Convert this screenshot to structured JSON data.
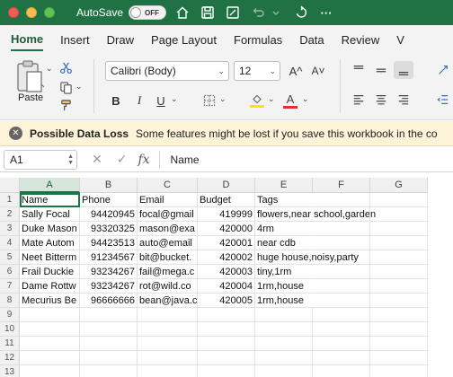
{
  "titlebar": {
    "autosave_label": "AutoSave",
    "autosave_state": "OFF",
    "more_label": "···"
  },
  "menu": {
    "tabs": [
      "Home",
      "Insert",
      "Draw",
      "Page Layout",
      "Formulas",
      "Data",
      "Review",
      "V"
    ],
    "active": "Home"
  },
  "ribbon": {
    "paste_label": "Paste",
    "font_name": "Calibri (Body)",
    "font_size": "12",
    "bold": "B",
    "italic": "I",
    "underline": "U",
    "grow_font": "A^",
    "shrink_font": "A˅",
    "font_color": "A",
    "font_color_hex": "#e03030",
    "highlight_hex": "#ffe600"
  },
  "warning": {
    "title": "Possible Data Loss",
    "message": "Some features might be lost if you save this workbook in the co"
  },
  "formula_bar": {
    "name_box": "A1",
    "fx": "fx",
    "value": "Name"
  },
  "grid": {
    "columns": [
      "A",
      "B",
      "C",
      "D",
      "E",
      "F",
      "G"
    ],
    "selected_column": "A",
    "row_numbers": [
      "1",
      "2",
      "3",
      "4",
      "5",
      "6",
      "7",
      "8",
      "9",
      "10",
      "11",
      "12",
      "13"
    ],
    "rows": [
      [
        "Name",
        "Phone",
        "Email",
        "Budget",
        "Tags"
      ],
      [
        "Sally Focal",
        "94420945",
        "focal@gmail",
        "419999",
        "flowers,near school,garden"
      ],
      [
        "Duke Mason",
        "93320325",
        "mason@exa",
        "420000",
        "4rm"
      ],
      [
        "Mate Autom",
        "94423513",
        "auto@email",
        "420001",
        "near cdb"
      ],
      [
        "Neet Bitterm",
        "91234567",
        "bit@bucket.",
        "420002",
        "huge house,noisy,party"
      ],
      [
        "Frail Duckie",
        "93234267",
        "fail@mega.c",
        "420003",
        "tiny,1rm"
      ],
      [
        "Dame Rottw",
        "93234267",
        "rot@wild.co",
        "420004",
        "1rm,house"
      ],
      [
        "Mecurius Be",
        "96666666",
        "bean@java.c",
        "420005",
        "1rm,house"
      ]
    ]
  },
  "colors": {
    "excel_green": "#207245",
    "warning_bg": "#fcf3d8"
  }
}
